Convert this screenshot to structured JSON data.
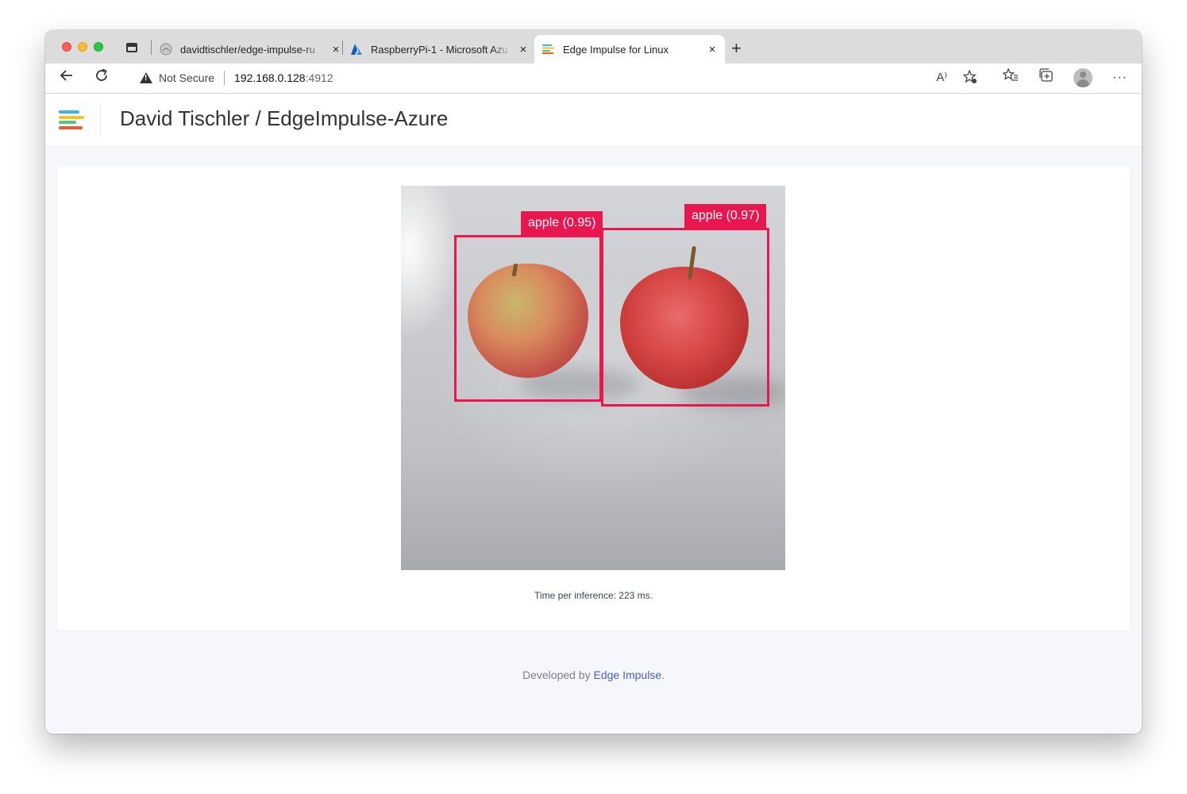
{
  "browser": {
    "tabs": [
      {
        "title": "davidtischler/edge-impulse-ru",
        "active": false,
        "favicon": "github-icon"
      },
      {
        "title": "RaspberryPi-1 - Microsoft Azu",
        "active": false,
        "favicon": "azure-icon"
      },
      {
        "title": "Edge Impulse for Linux",
        "active": true,
        "favicon": "edge-impulse-icon"
      }
    ],
    "close_glyph": "×",
    "new_tab_glyph": "+",
    "security_label": "Not Secure",
    "url_host": "192.168.0.128",
    "url_port": ":4912",
    "read_aloud_glyph": "A⁾",
    "more_glyph": "···"
  },
  "header": {
    "project_title": "David Tischler / EdgeImpulse-Azure"
  },
  "detections": [
    {
      "label": "apple (0.95)"
    },
    {
      "label": "apple (0.97)"
    }
  ],
  "inference": {
    "text": "Time per inference: 223 ms."
  },
  "footer": {
    "prefix": "Developed by ",
    "link": "Edge Impulse",
    "suffix": "."
  },
  "colors": {
    "bbox": "#e8174f",
    "link": "#4a5bd6"
  }
}
